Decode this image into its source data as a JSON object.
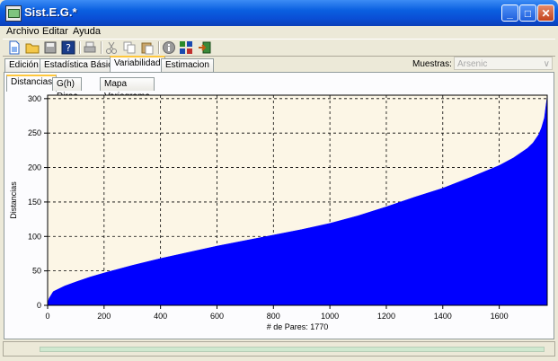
{
  "window": {
    "title": "Sist.E.G.*",
    "minimize_glyph": "_",
    "maximize_glyph": "□",
    "close_glyph": "✕"
  },
  "menu": {
    "items": [
      "Archivo",
      "Editar",
      "Ayuda"
    ]
  },
  "toolbar": {
    "icons": [
      "new-file-icon",
      "open-folder-icon",
      "save-icon",
      "help-icon",
      "print-icon",
      "cut-icon",
      "copy-icon",
      "paste-icon",
      "info-icon",
      "grid-icon",
      "export-icon"
    ]
  },
  "tabs": {
    "items": [
      "Edición",
      "Estadística Básica",
      "Variabilidad",
      "Estimacion"
    ],
    "active": 2
  },
  "muestras": {
    "label": "Muestras:",
    "selected": "Arsenic",
    "arrow": "∨"
  },
  "subtabs": {
    "items": [
      "Distancias",
      "G(h) Direc",
      "Mapa Variograma"
    ],
    "active": 0
  },
  "colors": {
    "fill": "#0000ff",
    "plot_bg": "#fcf6e6",
    "accent": "#ffc73c"
  },
  "chart_data": {
    "type": "area",
    "xlabel": "# de Pares: 1770",
    "ylabel": "Distancias",
    "xlim": [
      0,
      1770
    ],
    "ylim": [
      0,
      305
    ],
    "xticks": [
      0,
      200,
      400,
      600,
      800,
      1000,
      1200,
      1400,
      1600
    ],
    "yticks": [
      0,
      50,
      100,
      150,
      200,
      250,
      300
    ],
    "grid": true,
    "series": [
      {
        "x": [
          0,
          5,
          20,
          60,
          100,
          150,
          200,
          300,
          400,
          500,
          600,
          700,
          800,
          900,
          1000,
          1100,
          1200,
          1300,
          1400,
          1500,
          1600,
          1650,
          1700,
          1720,
          1740,
          1750,
          1760,
          1765,
          1770
        ],
        "values": [
          3,
          10,
          20,
          28,
          34,
          41,
          47,
          58,
          68,
          77,
          86,
          94,
          102,
          110,
          119,
          130,
          143,
          157,
          170,
          186,
          203,
          214,
          228,
          236,
          248,
          258,
          272,
          288,
          303
        ]
      }
    ]
  }
}
